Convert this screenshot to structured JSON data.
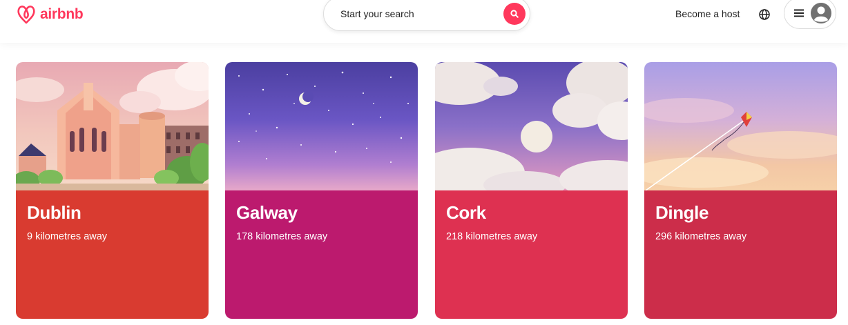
{
  "header": {
    "logo_text": "airbnb",
    "search_placeholder": "Start your search",
    "host_link": "Become a host"
  },
  "colors": {
    "brand": "#FF385C",
    "dublin": "#D93B30",
    "galway": "#BC1A6E",
    "cork": "#DE3151",
    "dingle": "#CC2D4A"
  },
  "icons": [
    "airbnb-logo-icon",
    "search-icon",
    "globe-icon",
    "menu-icon",
    "user-avatar-icon"
  ],
  "destinations": [
    {
      "city": "Dublin",
      "distance": "9 kilometres away"
    },
    {
      "city": "Galway",
      "distance": "178 kilometres away"
    },
    {
      "city": "Cork",
      "distance": "218 kilometres away"
    },
    {
      "city": "Dingle",
      "distance": "296 kilometres away"
    }
  ]
}
